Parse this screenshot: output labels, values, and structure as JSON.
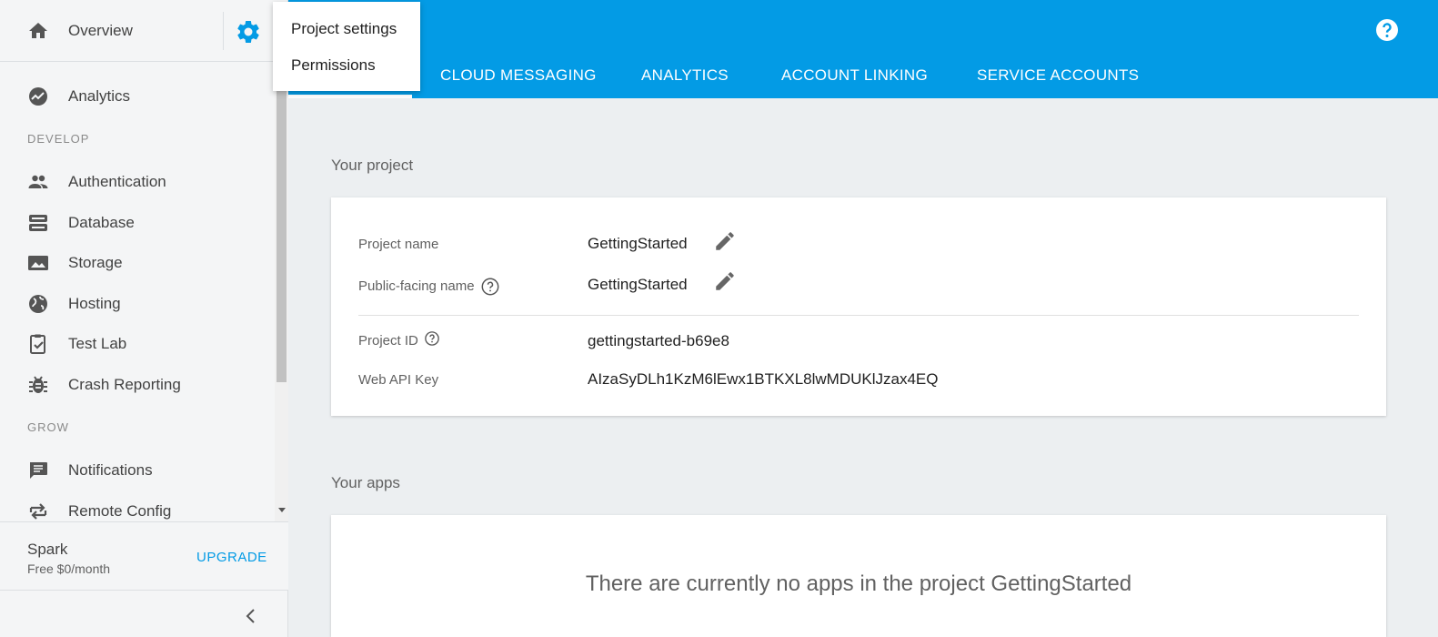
{
  "sidebar": {
    "overview_label": "Overview",
    "items": [
      {
        "label": "Analytics",
        "icon": "analytics-icon"
      },
      {
        "label": "Authentication",
        "icon": "people-icon"
      },
      {
        "label": "Database",
        "icon": "database-icon"
      },
      {
        "label": "Storage",
        "icon": "photo-icon"
      },
      {
        "label": "Hosting",
        "icon": "globe-icon"
      },
      {
        "label": "Test Lab",
        "icon": "clipboard-check-icon"
      },
      {
        "label": "Crash Reporting",
        "icon": "bug-icon"
      },
      {
        "label": "Notifications",
        "icon": "chat-icon"
      },
      {
        "label": "Remote Config",
        "icon": "swap-icon"
      }
    ],
    "sections": {
      "develop": "DEVELOP",
      "grow": "GROW"
    },
    "plan": {
      "name": "Spark",
      "price": "Free $0/month",
      "upgrade": "UPGRADE"
    }
  },
  "menu": {
    "items": [
      "Project settings",
      "Permissions"
    ]
  },
  "header": {
    "tabs": [
      "CLOUD MESSAGING",
      "ANALYTICS",
      "ACCOUNT LINKING",
      "SERVICE ACCOUNTS"
    ]
  },
  "project": {
    "section_title": "Your project",
    "fields": [
      {
        "label": "Project name",
        "value": "GettingStarted"
      },
      {
        "label": "Public-facing name",
        "value": "GettingStarted"
      },
      {
        "label": "Project ID",
        "value": "gettingstarted-b69e8"
      },
      {
        "label": "Web API Key",
        "value": "AIzaSyDLh1KzM6lEwx1BTKXL8lwMDUKlJzax4EQ"
      }
    ]
  },
  "apps": {
    "section_title": "Your apps",
    "empty_message": "There are currently no apps in the project GettingStarted"
  },
  "colors": {
    "accent": "#039be5",
    "sidebar_bg": "#f4f5f6",
    "main_bg": "#eceff1",
    "icon": "#555555"
  }
}
